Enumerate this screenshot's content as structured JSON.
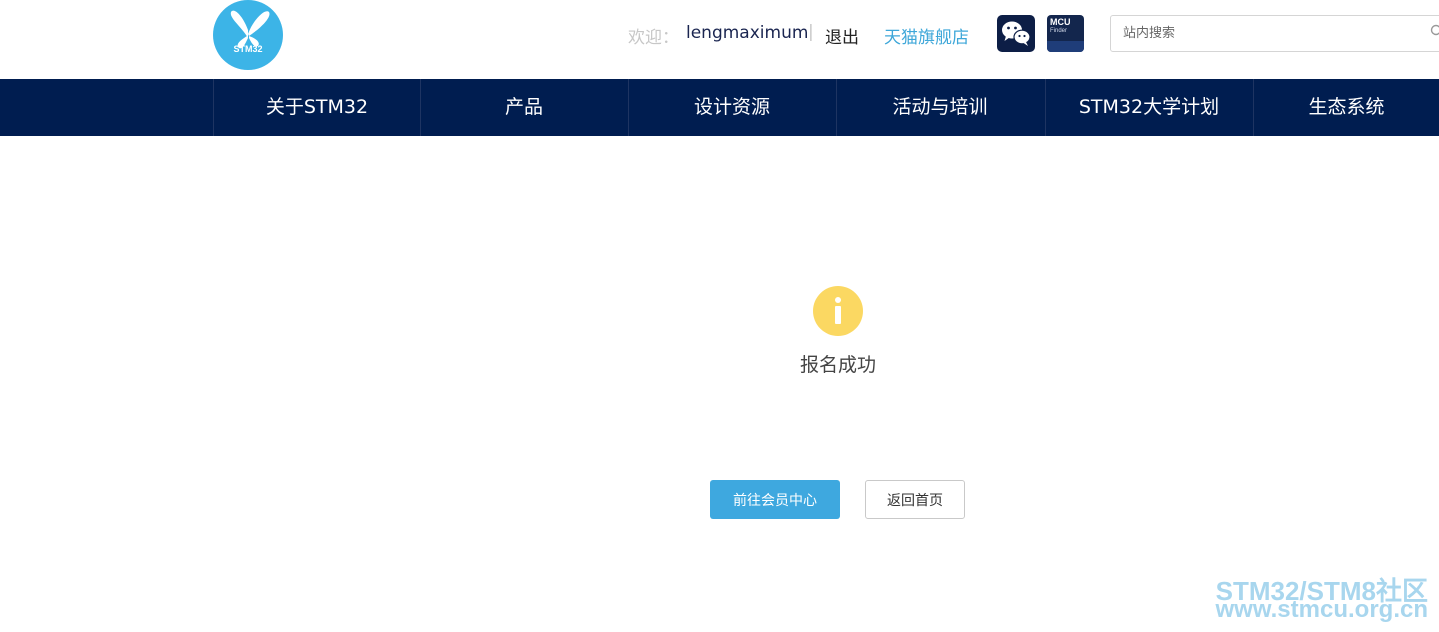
{
  "header": {
    "logo_text": "STM32",
    "welcome_label": "欢迎：",
    "username": "lengmaximum",
    "separator": "|",
    "logout_label": "退出",
    "tmall_label": "天猫旗舰店",
    "wechat_icon": "wechat-icon",
    "mcu_finder": {
      "title": "MCU",
      "subtitle": "Finder"
    },
    "search": {
      "placeholder": "站内搜索",
      "value": ""
    }
  },
  "nav": {
    "items": [
      {
        "label": "关于STM32"
      },
      {
        "label": "产品"
      },
      {
        "label": "设计资源"
      },
      {
        "label": "活动与培训"
      },
      {
        "label": "STM32大学计划"
      },
      {
        "label": "生态系统"
      }
    ]
  },
  "main": {
    "status_icon": "info-icon",
    "message": "报名成功",
    "primary_button": "前往会员中心",
    "secondary_button": "返回首页"
  },
  "watermark": {
    "line1": "STM32/STM8社区",
    "line2": "www.stmcu.org.cn"
  },
  "colors": {
    "nav_bg": "#001d50",
    "primary": "#3ea8df",
    "logo": "#3cb4e7",
    "info": "#fbd862"
  }
}
